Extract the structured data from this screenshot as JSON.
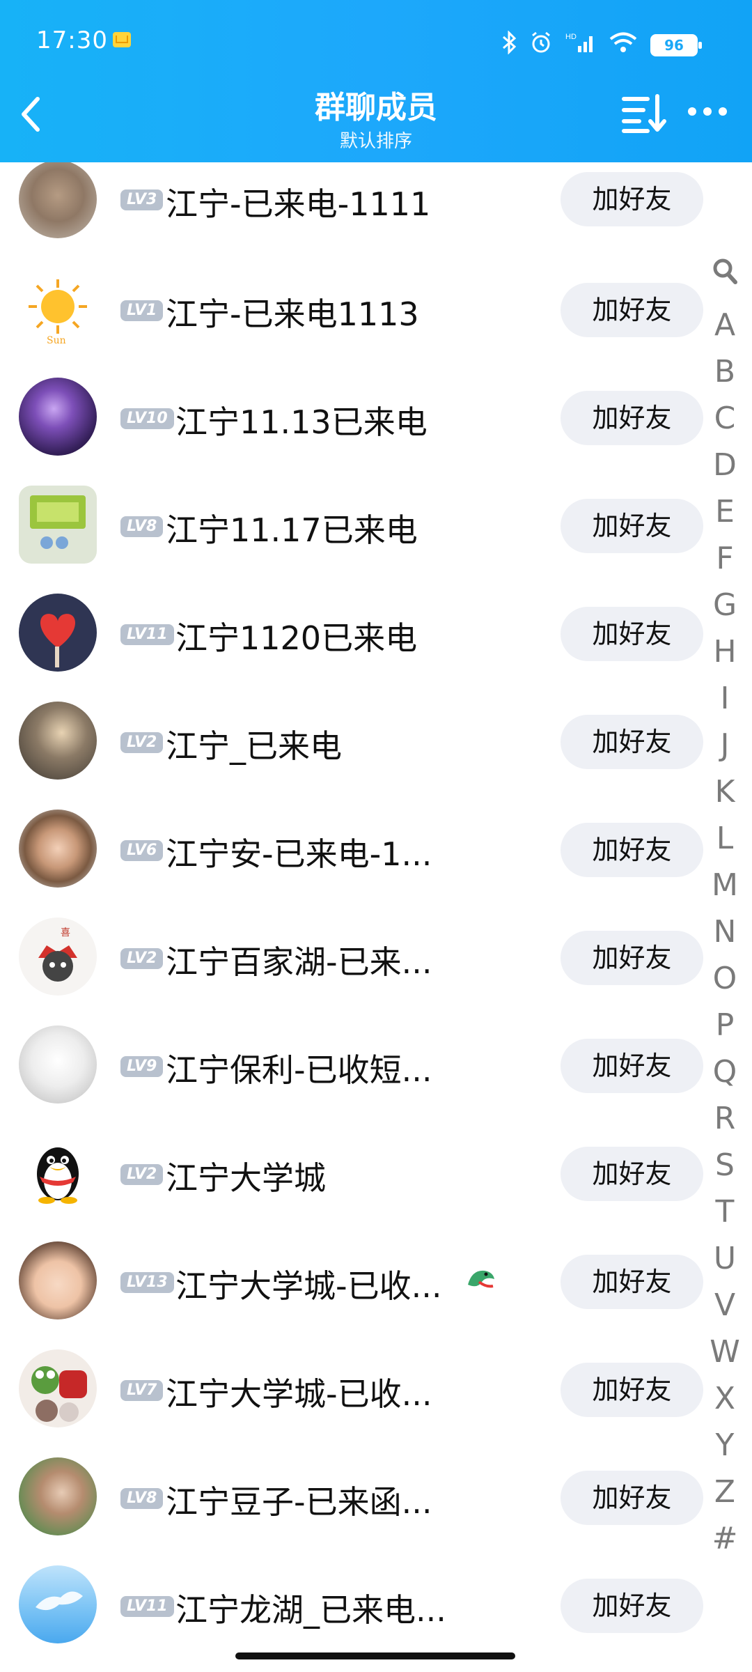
{
  "status": {
    "time": "17:30",
    "battery": "96",
    "signal": "HD"
  },
  "header": {
    "title": "群聊成员",
    "subtitle": "默认排序"
  },
  "members": [
    {
      "level": "LV3",
      "name": "江宁-已来电-1111",
      "button": "加好友"
    },
    {
      "level": "LV1",
      "name": "江宁-已来电1113",
      "button": "加好友"
    },
    {
      "level": "LV10",
      "name": "江宁11.13已来电",
      "button": "加好友"
    },
    {
      "level": "LV8",
      "name": "江宁11.17已来电",
      "button": "加好友"
    },
    {
      "level": "LV11",
      "name": "江宁1120已来电",
      "button": "加好友"
    },
    {
      "level": "LV2",
      "name": "江宁_已来电",
      "button": "加好友"
    },
    {
      "level": "LV6",
      "name": "江宁安-已来电-1...",
      "button": "加好友"
    },
    {
      "level": "LV2",
      "name": "江宁百家湖-已来...",
      "button": "加好友"
    },
    {
      "level": "LV9",
      "name": "江宁保利-已收短...",
      "button": "加好友"
    },
    {
      "level": "LV2",
      "name": "江宁大学城",
      "button": "加好友"
    },
    {
      "level": "LV13",
      "name": "江宁大学城-已收...",
      "button": "加好友"
    },
    {
      "level": "LV7",
      "name": "江宁大学城-已收...",
      "button": "加好友"
    },
    {
      "level": "LV8",
      "name": "江宁豆子-已来函...",
      "button": "加好友"
    },
    {
      "level": "LV11",
      "name": "江宁龙湖_已来电...",
      "button": "加好友"
    }
  ],
  "index_letters": [
    "A",
    "B",
    "C",
    "D",
    "E",
    "F",
    "G",
    "H",
    "I",
    "J",
    "K",
    "L",
    "M",
    "N",
    "O",
    "P",
    "Q",
    "R",
    "S",
    "T",
    "U",
    "V",
    "W",
    "X",
    "Y",
    "Z",
    "#"
  ],
  "colors": {
    "header": "#1aa9f8",
    "button_bg": "#eef0f5",
    "badge_bg": "#b8c1ce"
  }
}
